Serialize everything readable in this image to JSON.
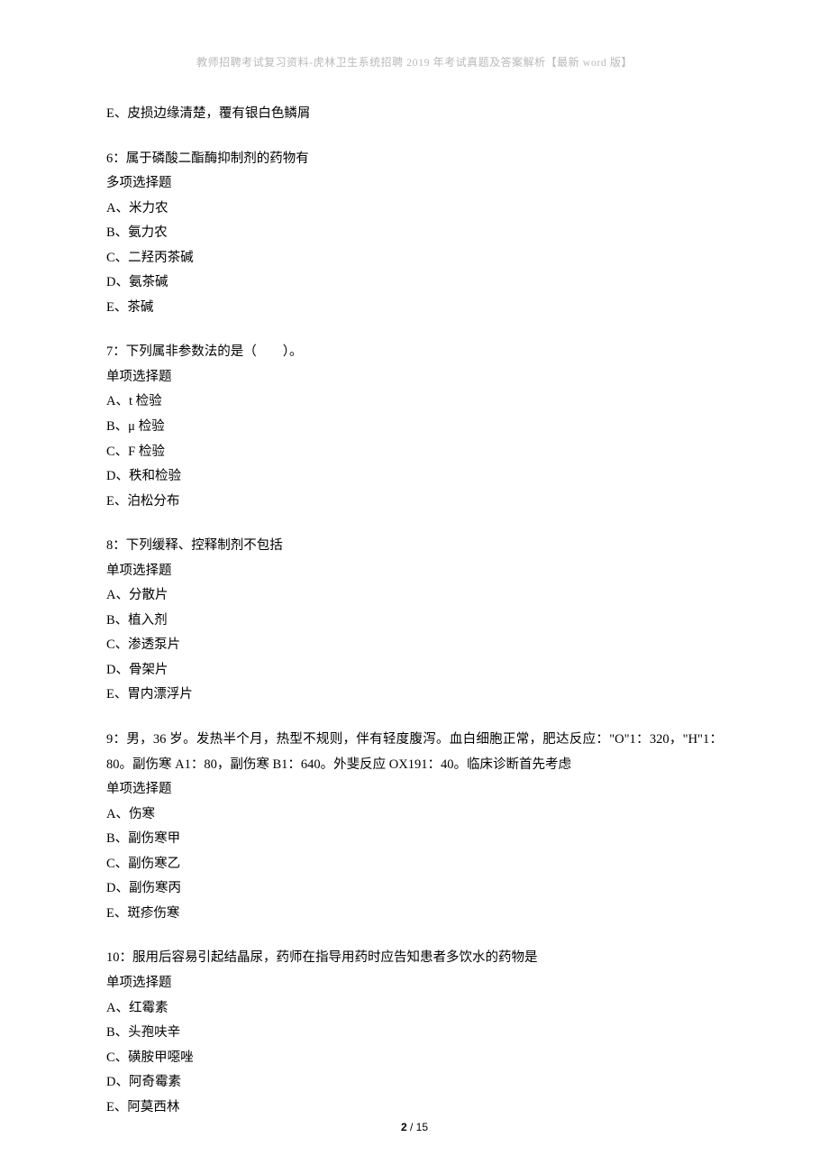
{
  "header": "教师招聘考试复习资料-虎林卫生系统招聘 2019 年考试真题及答案解析【最新 word 版】",
  "topline": "E、皮损边缘清楚，覆有银白色鳞屑",
  "questions": [
    {
      "num": "6",
      "stem": "属于磷酸二酯酶抑制剂的药物有",
      "type": "多项选择题",
      "opts": [
        "A、米力农",
        "B、氨力农",
        "C、二羟丙茶碱",
        "D、氨茶碱",
        "E、茶碱"
      ]
    },
    {
      "num": "7",
      "stem": "下列属非参数法的是（　　）。",
      "type": "单项选择题",
      "opts": [
        "A、t 检验",
        "B、μ 检验",
        "C、F 检验",
        "D、秩和检验",
        "E、泊松分布"
      ]
    },
    {
      "num": "8",
      "stem": "下列缓释、控释制剂不包括",
      "type": "单项选择题",
      "opts": [
        "A、分散片",
        "B、植入剂",
        "C、渗透泵片",
        "D、骨架片",
        "E、胃内漂浮片"
      ]
    },
    {
      "num": "9",
      "stem": "男，36 岁。发热半个月，热型不规则，伴有轻度腹泻。血白细胞正常，肥达反应：\"O\"1：320，\"H\"1：80。副伤寒 A1：80，副伤寒 B1：640。外斐反应 OX191：40。临床诊断首先考虑",
      "type": "单项选择题",
      "opts": [
        "A、伤寒",
        "B、副伤寒甲",
        "C、副伤寒乙",
        "D、副伤寒丙",
        "E、斑疹伤寒"
      ]
    },
    {
      "num": "10",
      "stem": "服用后容易引起结晶尿，药师在指导用药时应告知患者多饮水的药物是",
      "type": "单项选择题",
      "opts": [
        "A、红霉素",
        "B、头孢呋辛",
        "C、磺胺甲噁唑",
        "D、阿奇霉素",
        "E、阿莫西林"
      ]
    }
  ],
  "footer": {
    "current": "2",
    "sep": " / ",
    "total": "15"
  }
}
